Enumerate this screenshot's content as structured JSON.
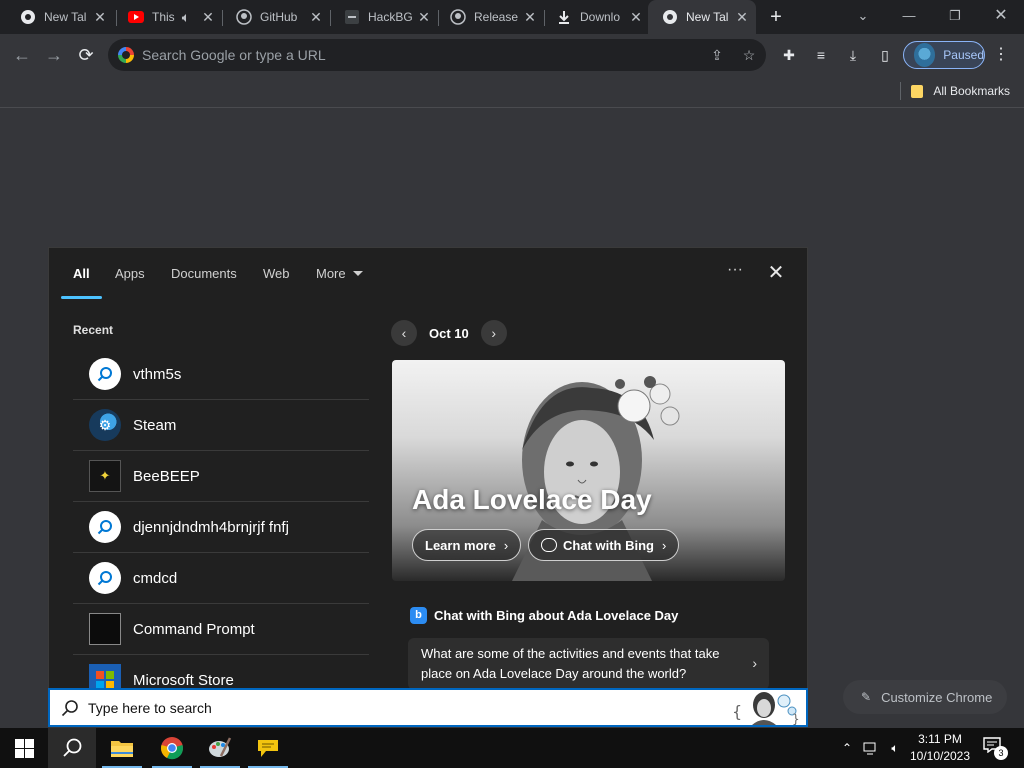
{
  "browser": {
    "tabs": [
      {
        "title": "New Tal",
        "icon": "chrome-icon",
        "audio": false
      },
      {
        "title": "This",
        "icon": "youtube-icon",
        "audio": true
      },
      {
        "title": "GitHub",
        "icon": "github-icon",
        "audio": false
      },
      {
        "title": "HackBG",
        "icon": "page-icon",
        "audio": false
      },
      {
        "title": "Release",
        "icon": "github-icon",
        "audio": false
      },
      {
        "title": "Downlo",
        "icon": "download-icon",
        "audio": false
      },
      {
        "title": "New Tal",
        "icon": "chrome-icon",
        "audio": false,
        "active": true
      }
    ],
    "omnibox_placeholder": "Search Google or type a URL",
    "profile_label": "Paused",
    "bookmarks_label": "All Bookmarks",
    "customize_label": "Customize Chrome"
  },
  "search_panel": {
    "tabs": [
      "All",
      "Apps",
      "Documents",
      "Web",
      "More"
    ],
    "active_tab": "All",
    "recent_header": "Recent",
    "recent_items": [
      {
        "label": "vthm5s",
        "icon": "search-icon"
      },
      {
        "label": "Steam",
        "icon": "steam-icon"
      },
      {
        "label": "BeeBEEP",
        "icon": "beebeep-icon"
      },
      {
        "label": "djennjdndmh4brnjrjf fnfj",
        "icon": "search-icon"
      },
      {
        "label": "cmdcd",
        "icon": "search-icon"
      },
      {
        "label": "Command Prompt",
        "icon": "command-prompt-icon"
      },
      {
        "label": "Microsoft Store",
        "icon": "microsoft-store-icon"
      }
    ],
    "date": "Oct 10",
    "hero": {
      "title": "Ada Lovelace Day",
      "learn_more": "Learn more",
      "chat_with_bing": "Chat with Bing"
    },
    "bing_header": "Chat with Bing about Ada Lovelace Day",
    "suggestion": "What are some of the activities and events that take place on Ada Lovelace Day around the world?",
    "searchbox_placeholder": "Type here to search"
  },
  "taskbar": {
    "apps": [
      "start",
      "search",
      "file-explorer",
      "chrome",
      "paint",
      "beebeep"
    ],
    "time": "3:11 PM",
    "date": "10/10/2023",
    "notification_count": "3"
  },
  "colors": {
    "accent": "#4cc2ff",
    "searchbox_border": "#0067c0",
    "chrome_bg": "#35363a"
  }
}
